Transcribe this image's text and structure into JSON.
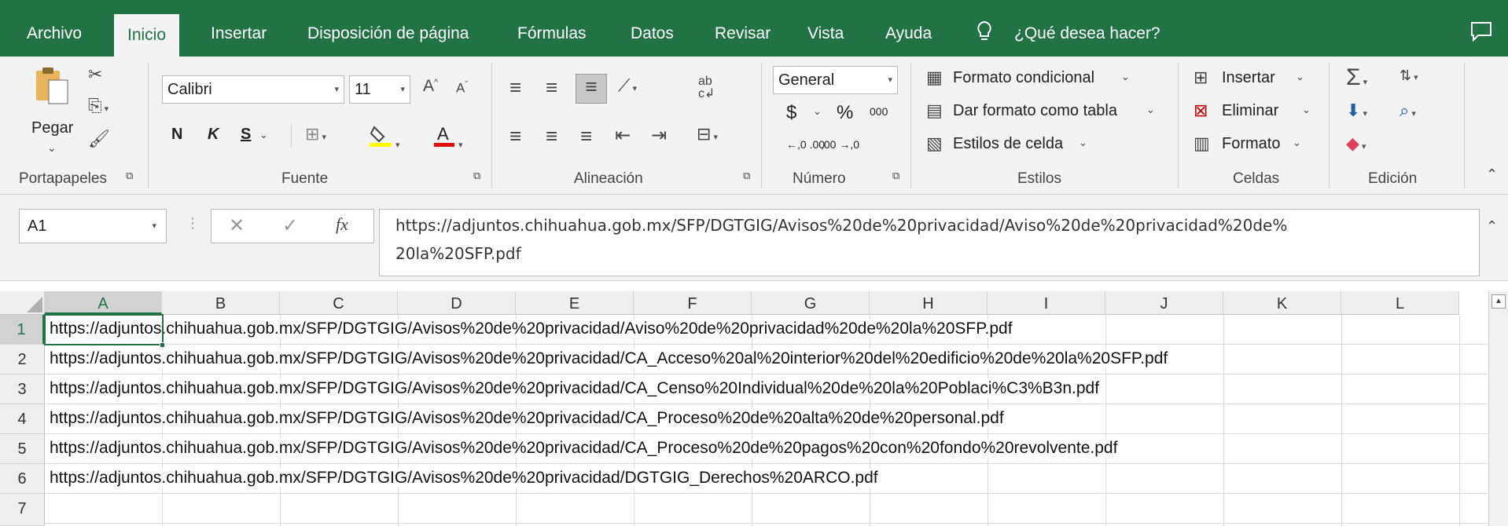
{
  "tabs": {
    "archivo": "Archivo",
    "inicio": "Inicio",
    "insertar": "Insertar",
    "disposicion": "Disposición de página",
    "formulas": "Fórmulas",
    "datos": "Datos",
    "revisar": "Revisar",
    "vista": "Vista",
    "ayuda": "Ayuda",
    "search": "¿Qué desea hacer?"
  },
  "ribbon": {
    "clipboard": {
      "paste": "Pegar",
      "label": "Portapapeles"
    },
    "font": {
      "name": "Calibri",
      "size": "11",
      "bold": "N",
      "italic": "K",
      "underline": "S",
      "label": "Fuente"
    },
    "alignment": {
      "label": "Alineación"
    },
    "number": {
      "format": "General",
      "currency": "$",
      "percent": "%",
      "thousands": "000",
      "inc_dec": "←,0 .00",
      "dec_dec": ",00 →,0",
      "label": "Número"
    },
    "styles": {
      "conditional": "Formato condicional",
      "table": "Dar formato como tabla",
      "cell": "Estilos de celda",
      "label": "Estilos"
    },
    "cells": {
      "insert": "Insertar",
      "delete": "Eliminar",
      "format": "Formato",
      "label": "Celdas"
    },
    "editing": {
      "label": "Edición"
    }
  },
  "formula_bar": {
    "name_box": "A1",
    "fx": "fx",
    "line1": "https://adjuntos.chihuahua.gob.mx/SFP/DGTGIG/Avisos%20de%20privacidad/Aviso%20de%20privacidad%20de%",
    "line2": "20la%20SFP.pdf"
  },
  "grid": {
    "columns": [
      "A",
      "B",
      "C",
      "D",
      "E",
      "F",
      "G",
      "H",
      "I",
      "J",
      "K",
      "L"
    ],
    "rows": [
      "1",
      "2",
      "3",
      "4",
      "5",
      "6",
      "7"
    ],
    "cells": [
      "https://adjuntos.chihuahua.gob.mx/SFP/DGTGIG/Avisos%20de%20privacidad/Aviso%20de%20privacidad%20de%20la%20SFP.pdf",
      "https://adjuntos.chihuahua.gob.mx/SFP/DGTGIG/Avisos%20de%20privacidad/CA_Acceso%20al%20interior%20del%20edificio%20de%20la%20SFP.pdf",
      "https://adjuntos.chihuahua.gob.mx/SFP/DGTGIG/Avisos%20de%20privacidad/CA_Censo%20Individual%20de%20la%20Poblaci%C3%B3n.pdf",
      "https://adjuntos.chihuahua.gob.mx/SFP/DGTGIG/Avisos%20de%20privacidad/CA_Proceso%20de%20alta%20de%20personal.pdf",
      "https://adjuntos.chihuahua.gob.mx/SFP/DGTGIG/Avisos%20de%20privacidad/CA_Proceso%20de%20pagos%20con%20fondo%20revolvente.pdf",
      "https://adjuntos.chihuahua.gob.mx/SFP/DGTGIG/Avisos%20de%20privacidad/DGTGIG_Derechos%20ARCO.pdf",
      ""
    ]
  },
  "colors": {
    "accent": "#217346",
    "ribbon_bg": "#f3f3f3",
    "header_bg": "#efefef"
  }
}
